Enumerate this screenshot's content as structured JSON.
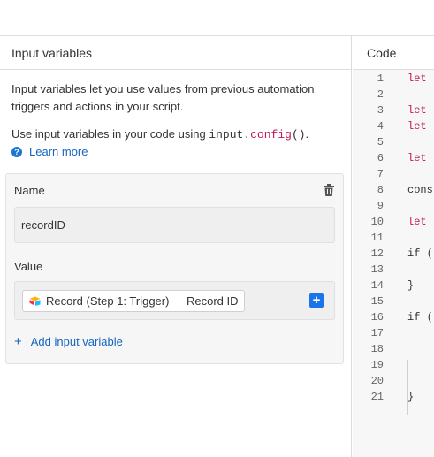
{
  "left_panel": {
    "title": "Input variables",
    "description": "Input variables let you use values from previous automation triggers and actions in your script.",
    "usage_prefix": "Use input variables in your code using ",
    "usage_code_object": "input",
    "usage_code_dot": ".",
    "usage_code_method": "config",
    "usage_code_parens": "()",
    "usage_suffix": ".",
    "learn_more": "Learn more",
    "variable": {
      "name_label": "Name",
      "name_value": "recordID",
      "value_label": "Value",
      "token_record": "Record (Step 1: Trigger)",
      "token_field": "Record ID",
      "add_token_label": "+"
    },
    "add_variable_label": "Add input variable"
  },
  "code_panel": {
    "title": "Code",
    "lines": [
      {
        "n": "1",
        "text": "let"
      },
      {
        "n": "2",
        "text": ""
      },
      {
        "n": "3",
        "text": "let"
      },
      {
        "n": "4",
        "text": "let"
      },
      {
        "n": "5",
        "text": ""
      },
      {
        "n": "6",
        "text": "let"
      },
      {
        "n": "7",
        "text": ""
      },
      {
        "n": "8",
        "text": "cons"
      },
      {
        "n": "9",
        "text": ""
      },
      {
        "n": "10",
        "text": "let"
      },
      {
        "n": "11",
        "text": ""
      },
      {
        "n": "12",
        "text": "if ("
      },
      {
        "n": "13",
        "text": ""
      },
      {
        "n": "14",
        "text": "}"
      },
      {
        "n": "15",
        "text": ""
      },
      {
        "n": "16",
        "text": "if ("
      },
      {
        "n": "17",
        "text": ""
      },
      {
        "n": "18",
        "text": ""
      },
      {
        "n": "19",
        "text": ""
      },
      {
        "n": "20",
        "text": ""
      },
      {
        "n": "21",
        "text": "}"
      }
    ]
  },
  "icons": {
    "help": "question-circle-icon",
    "trash": "trash-icon",
    "record_logo": "airtable-logo-icon",
    "add_token": "plus-square-icon",
    "add_variable": "plus-icon"
  },
  "colors": {
    "accent": "#1a73e8",
    "link": "#1565c0",
    "keyword": "#c2185b"
  }
}
